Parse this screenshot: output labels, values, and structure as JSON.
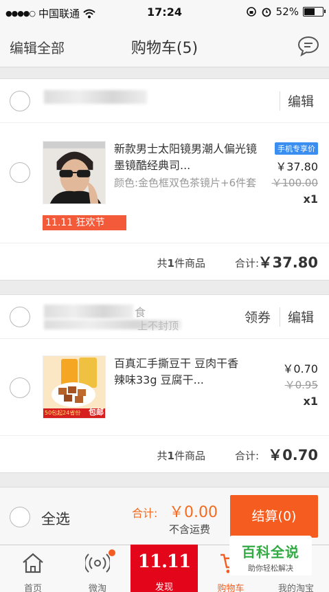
{
  "status_bar": {
    "carrier": "中国联通",
    "time": "17:24",
    "battery": "52%",
    "battery_level": 0.52
  },
  "header": {
    "edit_all": "编辑全部",
    "title": "购物车(5)",
    "message_icon": "message-bubble-icon"
  },
  "shops": [
    {
      "actions": {
        "edit": "编辑"
      },
      "item": {
        "title": "新款男士太阳镜男潮人偏光镜墨镜酷经典司...",
        "spec": "颜色:金色框双色茶镜片+6件套",
        "badge": "手机专享价",
        "price": "￥37.80",
        "original_price": "￥100.00",
        "qty": "x1",
        "promo_tag": "11.11 狂欢节"
      },
      "summary": {
        "count_prefix": "共",
        "count": "1",
        "count_suffix": "件商品",
        "total_label": "合计:",
        "total": "￥37.80"
      }
    },
    {
      "name_partial": "食",
      "subtitle_partial": "上不封顶",
      "actions": {
        "coupon": "领券",
        "edit": "编辑"
      },
      "item": {
        "title": "百真汇手撕豆干 豆肉干香辣味33g 豆腐干...",
        "price": "￥0.70",
        "original_price": "￥0.95",
        "qty": "x1",
        "thumb_banner": "50包起24省份",
        "thumb_badge": "包邮"
      },
      "summary": {
        "count_prefix": "共",
        "count": "1",
        "count_suffix": "件商品",
        "total_label": "合计:",
        "total": "￥0.70"
      }
    }
  ],
  "checkout": {
    "select_all": "全选",
    "total_label": "合计:",
    "total": "￥0.00",
    "shipping_note": "不含运费",
    "settle": "结算(0)"
  },
  "tabbar": [
    {
      "label": "首页",
      "icon": "home-icon"
    },
    {
      "label": "微淘",
      "icon": "broadcast-icon"
    },
    {
      "label": "发现",
      "promo": "11.11"
    },
    {
      "label": "购物车",
      "icon": "cart-icon",
      "active": true
    },
    {
      "label": "我的淘宝",
      "icon": "user-icon"
    }
  ],
  "watermark": {
    "main": "百科全说",
    "sub": "助你轻松解决"
  },
  "colors": {
    "accent": "#f45d1f",
    "promo_red": "#e3061a",
    "badge_blue": "#3a8ef0"
  }
}
